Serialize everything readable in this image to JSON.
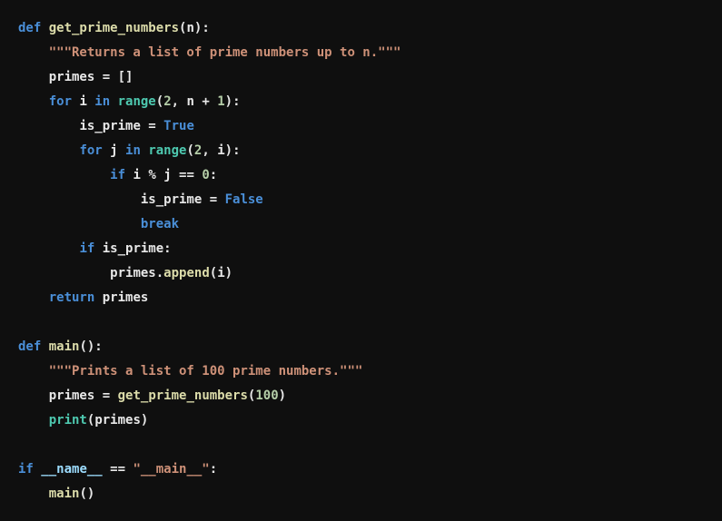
{
  "code": {
    "lines": [
      {
        "indent": 0,
        "tokens": [
          {
            "t": "def ",
            "c": "kw"
          },
          {
            "t": "get_prime_numbers",
            "c": "fn"
          },
          {
            "t": "(",
            "c": "punc"
          },
          {
            "t": "n",
            "c": "var"
          },
          {
            "t": ")",
            "c": "punc"
          },
          {
            "t": ":",
            "c": "punc"
          }
        ]
      },
      {
        "indent": 1,
        "tokens": [
          {
            "t": "\"\"\"Returns a list of prime numbers up to n.\"\"\"",
            "c": "str"
          }
        ]
      },
      {
        "indent": 1,
        "tokens": [
          {
            "t": "primes ",
            "c": "var"
          },
          {
            "t": "=",
            "c": "punc"
          },
          {
            "t": " ",
            "c": "punc"
          },
          {
            "t": "[]",
            "c": "punc"
          }
        ]
      },
      {
        "indent": 1,
        "tokens": [
          {
            "t": "for ",
            "c": "kw"
          },
          {
            "t": "i ",
            "c": "var"
          },
          {
            "t": "in ",
            "c": "kw"
          },
          {
            "t": "range",
            "c": "builtin"
          },
          {
            "t": "(",
            "c": "punc"
          },
          {
            "t": "2",
            "c": "num"
          },
          {
            "t": ", ",
            "c": "punc"
          },
          {
            "t": "n ",
            "c": "var"
          },
          {
            "t": "+",
            "c": "punc"
          },
          {
            "t": " ",
            "c": "punc"
          },
          {
            "t": "1",
            "c": "num"
          },
          {
            "t": ")",
            "c": "punc"
          },
          {
            "t": ":",
            "c": "punc"
          }
        ]
      },
      {
        "indent": 2,
        "tokens": [
          {
            "t": "is_prime ",
            "c": "var"
          },
          {
            "t": "=",
            "c": "punc"
          },
          {
            "t": " ",
            "c": "punc"
          },
          {
            "t": "True",
            "c": "bool"
          }
        ]
      },
      {
        "indent": 2,
        "tokens": [
          {
            "t": "for ",
            "c": "kw"
          },
          {
            "t": "j ",
            "c": "var"
          },
          {
            "t": "in ",
            "c": "kw"
          },
          {
            "t": "range",
            "c": "builtin"
          },
          {
            "t": "(",
            "c": "punc"
          },
          {
            "t": "2",
            "c": "num"
          },
          {
            "t": ", ",
            "c": "punc"
          },
          {
            "t": "i",
            "c": "var"
          },
          {
            "t": ")",
            "c": "punc"
          },
          {
            "t": ":",
            "c": "punc"
          }
        ]
      },
      {
        "indent": 3,
        "tokens": [
          {
            "t": "if ",
            "c": "kw"
          },
          {
            "t": "i ",
            "c": "var"
          },
          {
            "t": "%",
            "c": "punc"
          },
          {
            "t": " ",
            "c": "punc"
          },
          {
            "t": "j ",
            "c": "var"
          },
          {
            "t": "==",
            "c": "punc"
          },
          {
            "t": " ",
            "c": "punc"
          },
          {
            "t": "0",
            "c": "num"
          },
          {
            "t": ":",
            "c": "punc"
          }
        ]
      },
      {
        "indent": 4,
        "tokens": [
          {
            "t": "is_prime ",
            "c": "var"
          },
          {
            "t": "=",
            "c": "punc"
          },
          {
            "t": " ",
            "c": "punc"
          },
          {
            "t": "False",
            "c": "bool"
          }
        ]
      },
      {
        "indent": 4,
        "tokens": [
          {
            "t": "break",
            "c": "kw"
          }
        ]
      },
      {
        "indent": 2,
        "tokens": [
          {
            "t": "if ",
            "c": "kw"
          },
          {
            "t": "is_prime",
            "c": "var"
          },
          {
            "t": ":",
            "c": "punc"
          }
        ]
      },
      {
        "indent": 3,
        "tokens": [
          {
            "t": "primes",
            "c": "var"
          },
          {
            "t": ".",
            "c": "punc"
          },
          {
            "t": "append",
            "c": "fn"
          },
          {
            "t": "(",
            "c": "punc"
          },
          {
            "t": "i",
            "c": "var"
          },
          {
            "t": ")",
            "c": "punc"
          }
        ]
      },
      {
        "indent": 1,
        "tokens": [
          {
            "t": "return ",
            "c": "kw"
          },
          {
            "t": "primes",
            "c": "var"
          }
        ]
      },
      {
        "indent": 0,
        "tokens": []
      },
      {
        "indent": 0,
        "tokens": [
          {
            "t": "def ",
            "c": "kw"
          },
          {
            "t": "main",
            "c": "fn"
          },
          {
            "t": "()",
            "c": "punc"
          },
          {
            "t": ":",
            "c": "punc"
          }
        ]
      },
      {
        "indent": 1,
        "tokens": [
          {
            "t": "\"\"\"Prints a list of 100 prime numbers.\"\"\"",
            "c": "str"
          }
        ]
      },
      {
        "indent": 1,
        "tokens": [
          {
            "t": "primes ",
            "c": "var"
          },
          {
            "t": "=",
            "c": "punc"
          },
          {
            "t": " ",
            "c": "punc"
          },
          {
            "t": "get_prime_numbers",
            "c": "fn"
          },
          {
            "t": "(",
            "c": "punc"
          },
          {
            "t": "100",
            "c": "num"
          },
          {
            "t": ")",
            "c": "punc"
          }
        ]
      },
      {
        "indent": 1,
        "tokens": [
          {
            "t": "print",
            "c": "builtin"
          },
          {
            "t": "(",
            "c": "punc"
          },
          {
            "t": "primes",
            "c": "var"
          },
          {
            "t": ")",
            "c": "punc"
          }
        ]
      },
      {
        "indent": 0,
        "tokens": []
      },
      {
        "indent": 0,
        "tokens": [
          {
            "t": "if ",
            "c": "kw"
          },
          {
            "t": "__name__ ",
            "c": "dunder"
          },
          {
            "t": "==",
            "c": "punc"
          },
          {
            "t": " ",
            "c": "punc"
          },
          {
            "t": "\"__main__\"",
            "c": "str"
          },
          {
            "t": ":",
            "c": "punc"
          }
        ]
      },
      {
        "indent": 1,
        "tokens": [
          {
            "t": "main",
            "c": "fn"
          },
          {
            "t": "()",
            "c": "punc"
          }
        ]
      }
    ]
  },
  "colors": {
    "background": "#0f0f0f",
    "keyword": "#4a8fd8",
    "function": "#dcdcaa",
    "builtin": "#4ec9b0",
    "number": "#b5cea8",
    "string": "#ce9178",
    "variable": "#e8e8e8"
  }
}
